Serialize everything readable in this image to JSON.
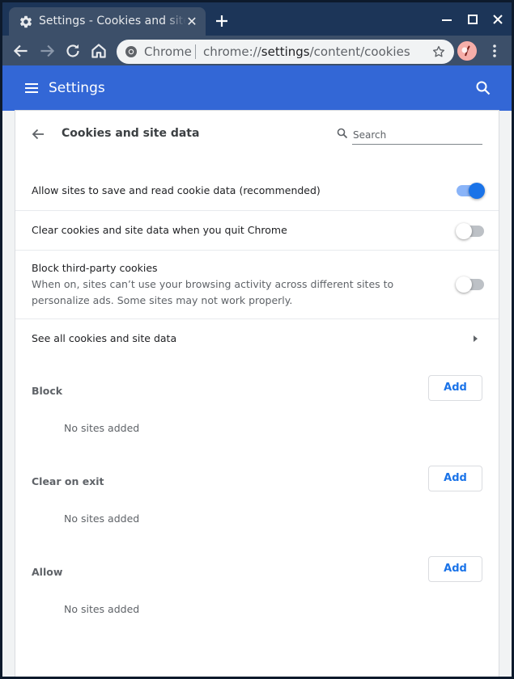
{
  "window": {
    "tab_title": "Settings - Cookies and site data",
    "tab_close": "✕"
  },
  "toolbar": {
    "scheme_label": "Chrome",
    "url_prefix": "chrome://",
    "url_host": "settings",
    "url_path": "/content/cookies"
  },
  "header": {
    "title": "Settings"
  },
  "subpage": {
    "title": "Cookies and site data",
    "search_placeholder": "Search"
  },
  "settings": {
    "allow_cookies": {
      "label": "Allow sites to save and read cookie data (recommended)",
      "enabled": true
    },
    "clear_on_quit": {
      "label": "Clear cookies and site data when you quit Chrome",
      "enabled": false
    },
    "block_third_party": {
      "label": "Block third-party cookies",
      "description": "When on, sites can’t use your browsing activity across different sites to personalize ads. Some sites may not work properly.",
      "enabled": false
    },
    "see_all": {
      "label": "See all cookies and site data"
    }
  },
  "lists": [
    {
      "label": "Block",
      "add_label": "Add",
      "empty_text": "No sites added"
    },
    {
      "label": "Clear on exit",
      "add_label": "Add",
      "empty_text": "No sites added"
    },
    {
      "label": "Allow",
      "add_label": "Add",
      "empty_text": "No sites added"
    }
  ],
  "colors": {
    "header_blue": "#3367d6",
    "toggle_on": "#1a73e8",
    "tabstrip": "#1c3558"
  },
  "icons": [
    "gear-icon",
    "close-icon",
    "plus-icon",
    "minimize-icon",
    "maximize-icon",
    "back-icon",
    "forward-icon",
    "reload-icon",
    "home-icon",
    "chrome-icon",
    "star-icon",
    "avatar",
    "more-vert-icon",
    "menu-icon",
    "search-icon",
    "arrow-back-icon",
    "chevron-right-icon"
  ]
}
